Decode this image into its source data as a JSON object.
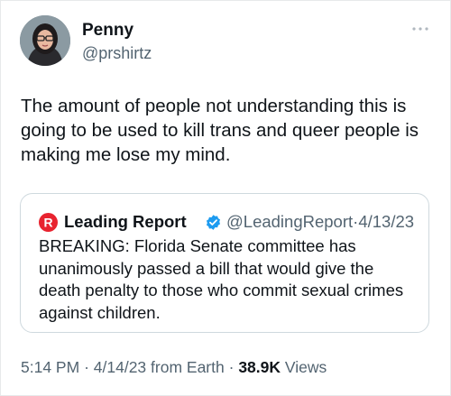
{
  "author": {
    "name": "Penny",
    "handle": "@prshirtz",
    "avatar_icon": "user-avatar-photo"
  },
  "more_icon": "more-options-icon",
  "tweet": {
    "text": "The amount of people not understanding this is going to be used to kill trans and queer people is making me lose my mind."
  },
  "quote": {
    "logo_icon": "leading-report-logo-icon",
    "logo_letter": "R",
    "name": "Leading Report",
    "verified_icon": "verified-badge-icon",
    "handle": "@LeadingReport",
    "separator": "·",
    "date": "4/13/23",
    "text": "BREAKING: Florida Senate committee has unanimously passed a bill that would give the death penalty to those who commit sexual crimes against children."
  },
  "meta": {
    "time": "5:14 PM",
    "separator1": "·",
    "date": "4/14/23",
    "location_text": "from Earth",
    "separator2": "·",
    "views_count": "38.9K",
    "views_label": "Views"
  },
  "colors": {
    "text": "#0f1419",
    "secondary": "#536471",
    "border": "#cfd9de",
    "verified": "#1d9bf0",
    "brand_red": "#e8232f"
  }
}
